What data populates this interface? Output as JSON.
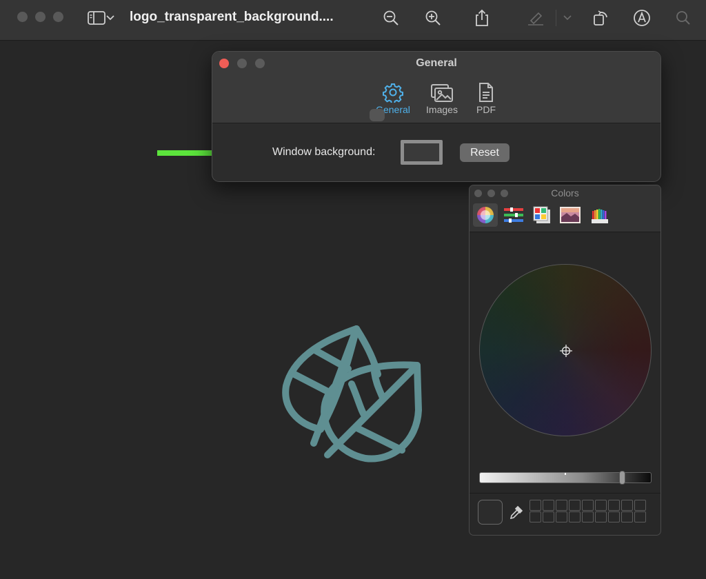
{
  "toolbar": {
    "title": "logo_transparent_background....",
    "icons": [
      "sidebar-icon",
      "chevron-down-icon",
      "zoom-out-icon",
      "zoom-in-icon",
      "share-icon",
      "highlight-icon",
      "rotate-icon",
      "markup-icon",
      "search-icon"
    ]
  },
  "prefs_window": {
    "title": "General",
    "tabs": [
      {
        "label": "General",
        "icon": "gear-icon",
        "active": true
      },
      {
        "label": "Images",
        "icon": "images-icon",
        "active": false
      },
      {
        "label": "PDF",
        "icon": "document-icon",
        "active": false
      }
    ],
    "window_background_label": "Window background:",
    "reset_label": "Reset"
  },
  "colors_panel": {
    "title": "Colors",
    "modes": [
      "color-wheel",
      "color-sliders",
      "color-palettes",
      "image-palettes",
      "pencils"
    ],
    "brightness_level": 0.84
  },
  "colors": {
    "accent": "#4fb1ea",
    "arrow": "#5ce43c",
    "leaf": "#5f8f92",
    "close": "#ee5d56"
  }
}
